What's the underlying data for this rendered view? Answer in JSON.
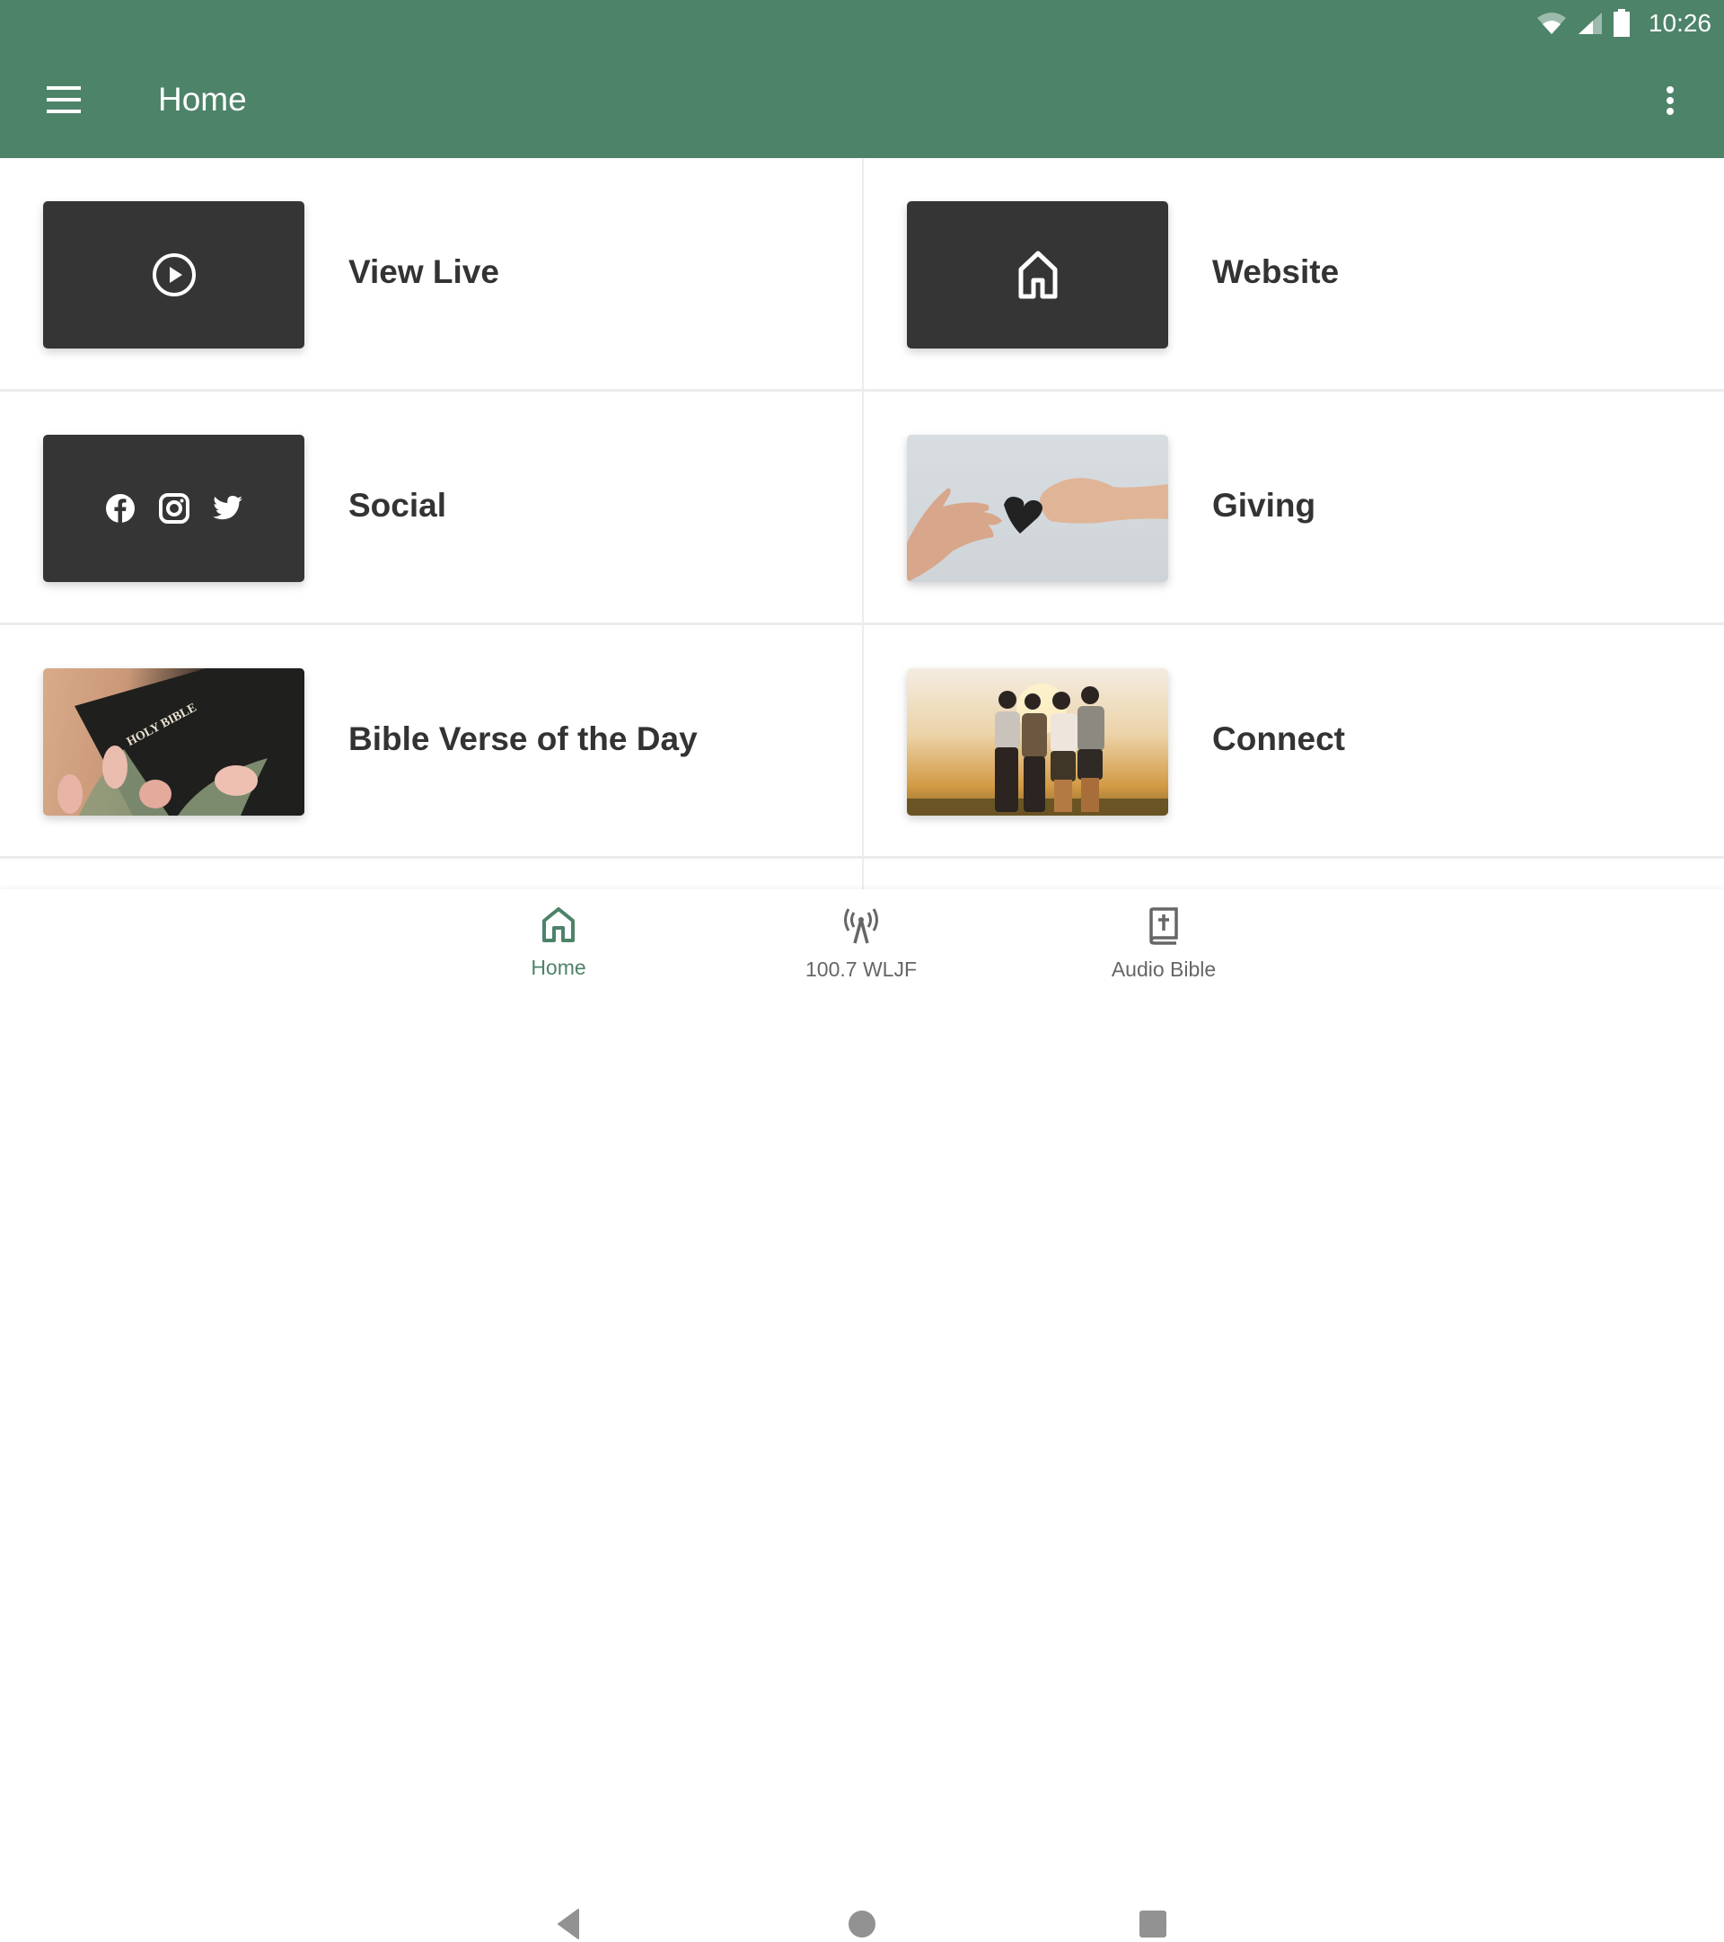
{
  "status_bar": {
    "time": "10:26",
    "icons": [
      "wifi-icon",
      "cell-signal-icon",
      "battery-icon"
    ]
  },
  "app_bar": {
    "title": "Home",
    "menu_icon": "hamburger-menu-icon",
    "overflow_icon": "more-vertical-icon",
    "color": "#4d8369"
  },
  "tiles": [
    {
      "label": "View Live",
      "thumb": "play-circle-icon"
    },
    {
      "label": "Website",
      "thumb": "home-outline-icon"
    },
    {
      "label": "Social",
      "thumb": "social-icons"
    },
    {
      "label": "Giving",
      "thumb": "photo-hands-heart"
    },
    {
      "label": "Bible Verse of the Day",
      "thumb": "photo-holy-bible-tulips",
      "image_text": "HOLY BIBLE"
    },
    {
      "label": "Connect",
      "thumb": "photo-friends-sunset"
    }
  ],
  "bottom_nav": [
    {
      "label": "Home",
      "icon": "home-icon",
      "active": true
    },
    {
      "label": "100.7 WLJF",
      "icon": "radio-tower-icon",
      "active": false
    },
    {
      "label": "Audio Bible",
      "icon": "bible-icon",
      "active": false
    }
  ],
  "system_nav": [
    "back-icon",
    "home-circle-icon",
    "recents-icon"
  ],
  "colors": {
    "accent": "#4d8369",
    "tile_dark": "#353535",
    "text": "#333333",
    "inactive": "#666666"
  }
}
